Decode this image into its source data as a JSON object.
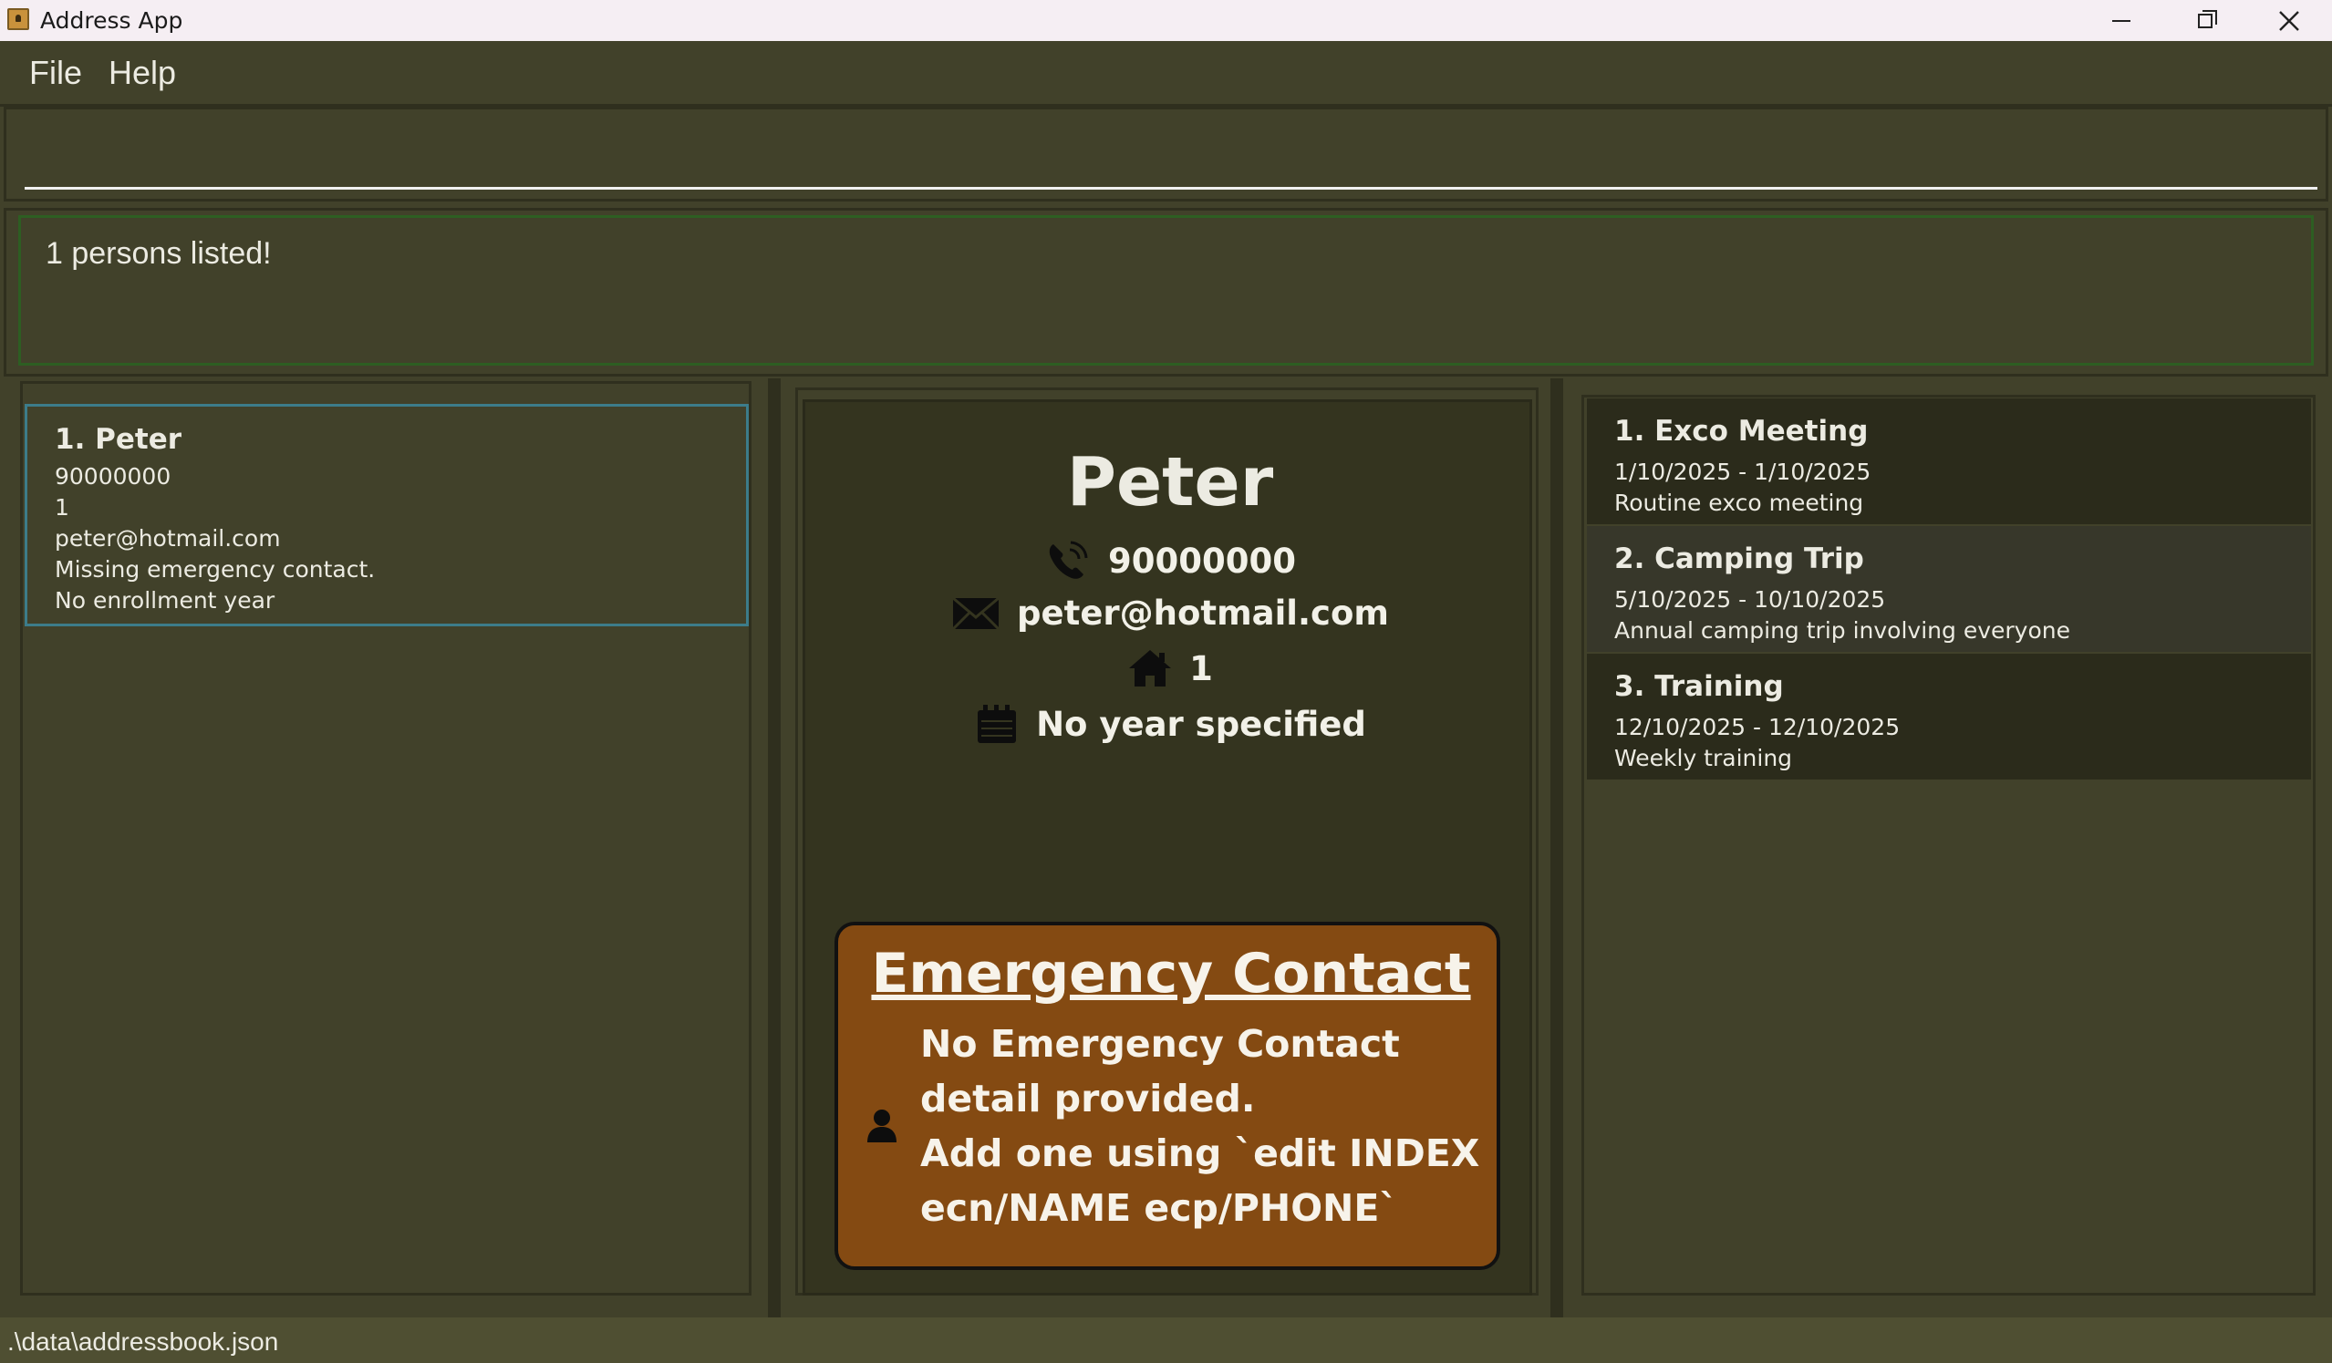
{
  "window": {
    "title": "Address App"
  },
  "menu": {
    "file": "File",
    "help": "Help"
  },
  "command": {
    "value": "",
    "placeholder": ""
  },
  "result": {
    "message": "1 persons listed!"
  },
  "person_list": [
    {
      "name": "1. Peter",
      "phone": "90000000",
      "address": "1",
      "email": "peter@hotmail.com",
      "emergency": "Missing emergency contact.",
      "year": "No enrollment year"
    }
  ],
  "detail": {
    "name": "Peter",
    "phone": "90000000",
    "email": "peter@hotmail.com",
    "address": "1",
    "year": "No year specified",
    "emergency": {
      "title": "Emergency Contact",
      "line1": "No Emergency Contact detail provided.",
      "line2": "Add one using `edit INDEX ecn/NAME ecp/PHONE`"
    }
  },
  "events": [
    {
      "title": "1. Exco Meeting",
      "dates": "1/10/2025 - 1/10/2025",
      "description": "Routine exco meeting"
    },
    {
      "title": "2. Camping Trip",
      "dates": "5/10/2025 - 10/10/2025",
      "description": "Annual camping trip involving everyone"
    },
    {
      "title": "3. Training",
      "dates": "12/10/2025 - 12/10/2025",
      "description": "Weekly training"
    }
  ],
  "status": {
    "file_path": ".\\data\\addressbook.json"
  },
  "icons": {
    "app": "address-app-icon",
    "phone": "phone-icon",
    "email": "envelope-icon",
    "address": "home-icon",
    "year": "calendar-icon",
    "emergency": "person-icon"
  },
  "colors": {
    "background": "#41412a",
    "detail_panel": "#34341f",
    "emergency_box": "#844a12",
    "selected_border": "#3c7c8a",
    "result_border": "#2d5e22"
  }
}
